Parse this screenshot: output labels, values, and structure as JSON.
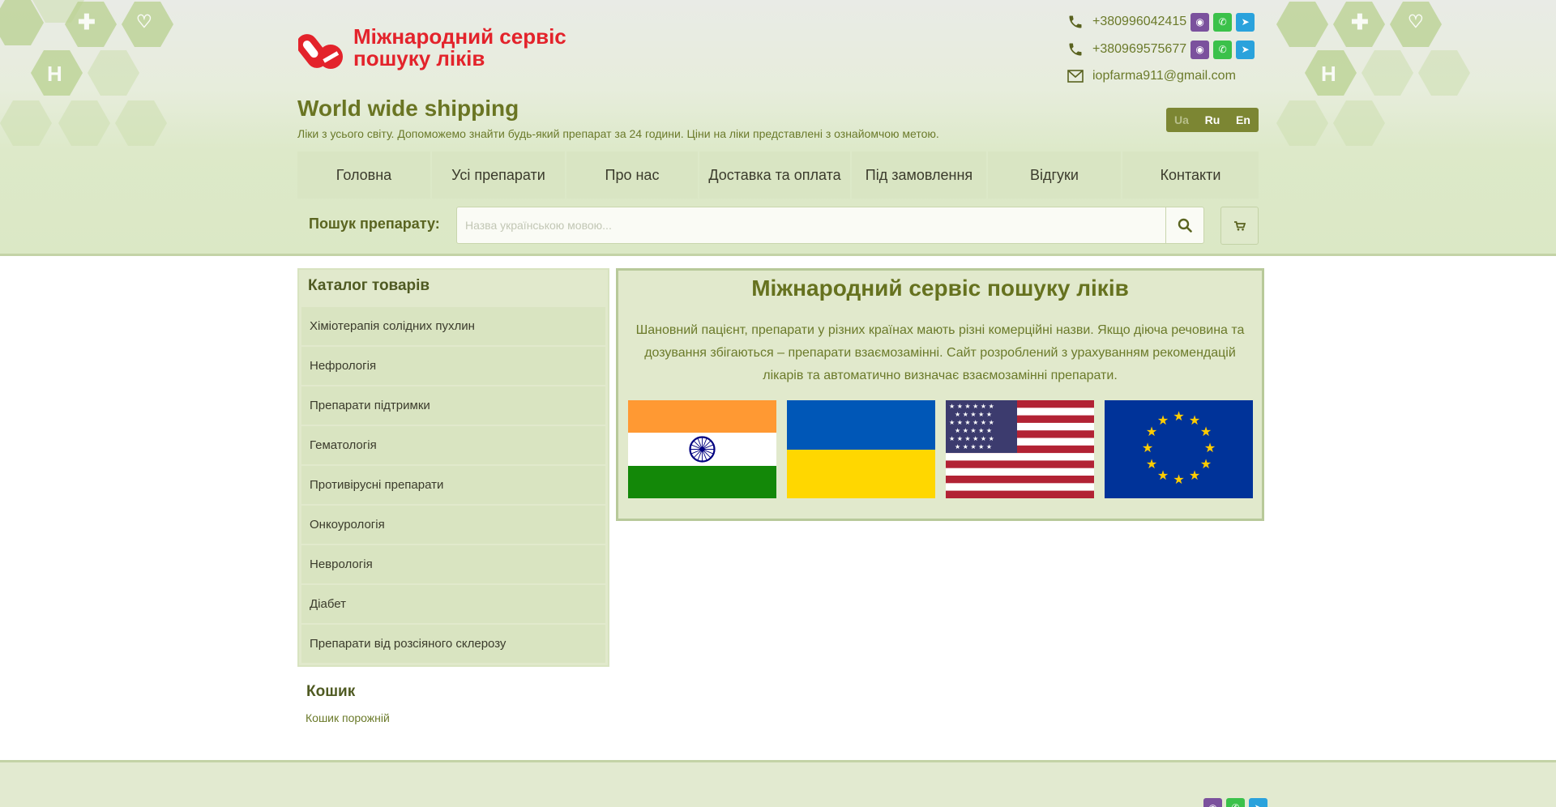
{
  "site": {
    "logo_line1": "Міжнародний сервіс",
    "logo_line2": "пошуку ліків",
    "tagline": "World wide shipping",
    "subline": "Ліки з усього світу. Допоможемо знайти будь-який препарат за 24 години. Ціни на ліки представлені з ознайомчою метою."
  },
  "contacts": {
    "phone1": "+380996042415",
    "phone2": "+380969575677",
    "email": "iopfarma911@gmail.com",
    "icons": [
      "phone-icon",
      "phone-icon",
      "mail-icon",
      "viber-icon",
      "whatsapp-icon",
      "telegram-icon"
    ]
  },
  "languages": [
    "Ua",
    "Ru",
    "En"
  ],
  "active_language": "Ua",
  "nav": [
    "Головна",
    "Усі препарати",
    "Про нас",
    "Доставка та оплата",
    "Під замовлення",
    "Відгуки",
    "Контакти"
  ],
  "search": {
    "label": "Пошук препарату:",
    "placeholder": "Назва українською мовою..."
  },
  "catalog": {
    "title": "Каталог товарів",
    "items": [
      "Хіміотерапія солідних пухлин",
      "Нефрологія",
      "Препарати підтримки",
      "Гематологія",
      "Противірусні препарати",
      "Онкоурологія",
      "Неврологія",
      "Діабет",
      "Препарати від розсіяного склерозу"
    ]
  },
  "cart": {
    "title": "Кошик",
    "empty": "Кошик порожній"
  },
  "main": {
    "title": "Міжнародний сервіс пошуку ліків",
    "text": "Шановний пацієнт, препарати у різних країнах мають різні комерційні назви. Якщо діюча речовина та дозування збігаються – препарати взаємозамінні. Сайт розроблений з урахуванням рекомендацій лікарів та автоматично визначає взаємозамінні препарати.",
    "flags": [
      "india-flag",
      "ukraine-flag",
      "usa-flag",
      "eu-flag"
    ]
  },
  "colors": {
    "brand_red": "#e3232b",
    "olive": "#6a7523",
    "panel_bg": "#e1e9cc",
    "header_bg": "#dde9c9"
  }
}
